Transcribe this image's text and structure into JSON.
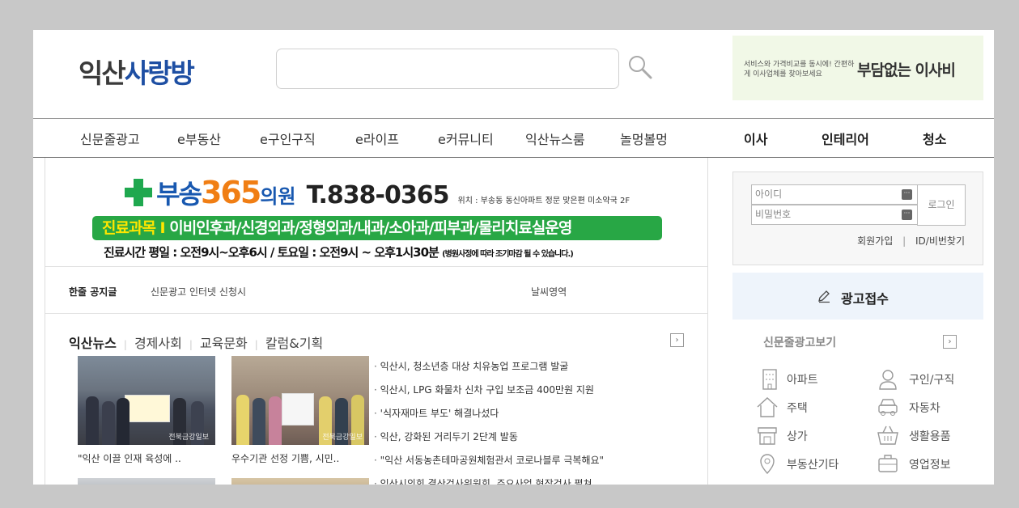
{
  "header": {
    "logo_part1": "익산",
    "logo_part2": "사랑방",
    "search_placeholder": "",
    "banner_small": "서비스와 가격비교를 동시에! 간편하게 이사업체를 찾아보세요",
    "banner_big": "부담없는 이사비"
  },
  "nav": {
    "items": [
      "신문줄광고",
      "e부동산",
      "e구인구직",
      "e라이프",
      "e커뮤니티",
      "익산뉴스룸",
      "놀멍볼멍"
    ],
    "right_items": [
      "이사",
      "인테리어",
      "청소"
    ]
  },
  "ad": {
    "name": "부송",
    "num": "365",
    "suffix": "의원",
    "tel": "T.838-0365",
    "location": "위치 : 부송동 동신아파트 정문 맞은편 미소약국 2F",
    "dept_label": "진료과목 I",
    "departments": "이비인후과/신경외과/정형외과/내과/소아과/피부과/물리치료실운영",
    "hours": "진료시간 평일 : 오전9시~오후6시 / 토요일 : 오전9시 ~ 오후1시30분",
    "hours_note": "(병원사정에 따라 조기마감 될 수 있습니다.)"
  },
  "notice": {
    "label": "한줄 공지글",
    "text": "신문광고 인터넷 신청시",
    "weather": "날씨영역"
  },
  "news": {
    "tabs": [
      "익산뉴스",
      "경제사회",
      "교육문화",
      "칼럼&기획"
    ],
    "thumbs": [
      {
        "caption": "\"익산 이끌 인재 육성에 ..",
        "watermark": "전북금강일보"
      },
      {
        "caption": "우수기관 선정 기쁨, 시민..",
        "watermark": "전북금강일보"
      }
    ],
    "list": [
      "익산시, 청소년층 대상 치유농업 프로그램 발굴",
      "익산시, LPG 화물차 신차 구입 보조금 400만원 지원",
      "'식자재마트 부도' 해결나섰다",
      "익산, 강화된 거리두기 2단계 발동",
      "\"익산 서동농촌테마공원체험관서 코로나블루 극복해요\"",
      "익산시의회 결산검사위원회, 주요사업 현장검사 펼쳐"
    ]
  },
  "login": {
    "id_placeholder": "아이디",
    "pw_placeholder": "비밀번호",
    "button": "로그인",
    "join": "회원가입",
    "sep": "|",
    "find": "ID/비번찾기"
  },
  "ad_receive": "광고접수",
  "classified": {
    "title": "신문줄광고보기",
    "items": [
      {
        "label": "아파트",
        "icon": "building-icon"
      },
      {
        "label": "구인/구직",
        "icon": "person-icon"
      },
      {
        "label": "주택",
        "icon": "house-icon"
      },
      {
        "label": "자동차",
        "icon": "car-icon"
      },
      {
        "label": "상가",
        "icon": "store-icon"
      },
      {
        "label": "생활용품",
        "icon": "basket-icon"
      },
      {
        "label": "부동산기타",
        "icon": "map-pin-icon"
      },
      {
        "label": "영업정보",
        "icon": "briefcase-icon"
      }
    ]
  },
  "colors": {
    "brand_blue": "#1e4fa3",
    "ad_green": "#28a745",
    "ad_orange": "#f07e14",
    "banner_bg": "#f1f8e7",
    "ad_recv_bg": "#eef4fb"
  }
}
